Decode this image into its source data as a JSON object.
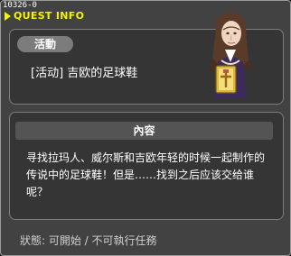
{
  "window": {
    "quest_id": "10326-0",
    "title": "QUEST INFO"
  },
  "quest": {
    "category_badge": "活動",
    "name": "[活动] 吉欧的足球鞋",
    "npc_icon": "npc-portrait-icon"
  },
  "content": {
    "header": "內容",
    "description": "寻找拉玛人、威尔斯和吉欧年轻的时候一起制作的传说中的足球鞋！但是……找到之后应该交给谁呢？"
  },
  "footer": {
    "status": "狀態: 可開始 / 不可執行任務"
  },
  "colors": {
    "title_accent": "#f4f400",
    "window_bg": "#424242",
    "panel_bg": "#353535"
  }
}
